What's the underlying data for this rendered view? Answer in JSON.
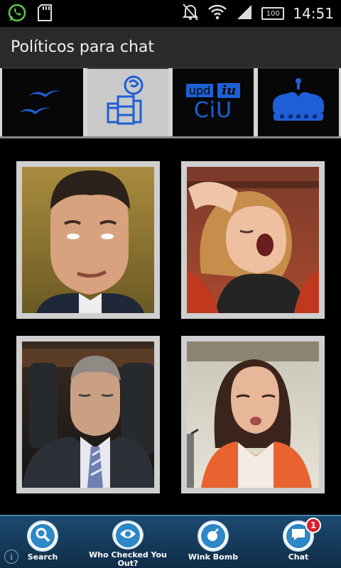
{
  "status_bar": {
    "time": "14:51",
    "battery_text": "100",
    "icons": [
      "whatsapp-icon",
      "sd-card-icon",
      "alarm-off-icon",
      "wifi-icon",
      "signal-icon",
      "battery-icon"
    ]
  },
  "app": {
    "title": "Políticos para chat"
  },
  "tabs": [
    {
      "name": "pp-logo",
      "active": false
    },
    {
      "name": "psoe-logo",
      "active": true
    },
    {
      "name": "upd-iu-ciu-logos",
      "active": false,
      "text_upd": "upd",
      "text_iu": "iu",
      "text_ciu": "CiU"
    },
    {
      "name": "crown-logo",
      "active": false
    }
  ],
  "gallery": {
    "items": [
      {
        "name": "politician-photo-1"
      },
      {
        "name": "politician-photo-2"
      },
      {
        "name": "politician-photo-3"
      },
      {
        "name": "politician-photo-4"
      }
    ]
  },
  "bottom_bar": {
    "items": [
      {
        "label": "Search",
        "icon": "search-icon"
      },
      {
        "label": "Who Checked You Out?",
        "icon": "eye-icon"
      },
      {
        "label": "Wink Bomb",
        "icon": "bomb-icon"
      },
      {
        "label": "Chat",
        "icon": "chat-icon",
        "badge": "1"
      }
    ]
  },
  "colors": {
    "accent": "#1e5fd6",
    "title_bar": "#2b2b2b",
    "bottom_bar": "#1c4a70",
    "badge": "#d8202a"
  }
}
